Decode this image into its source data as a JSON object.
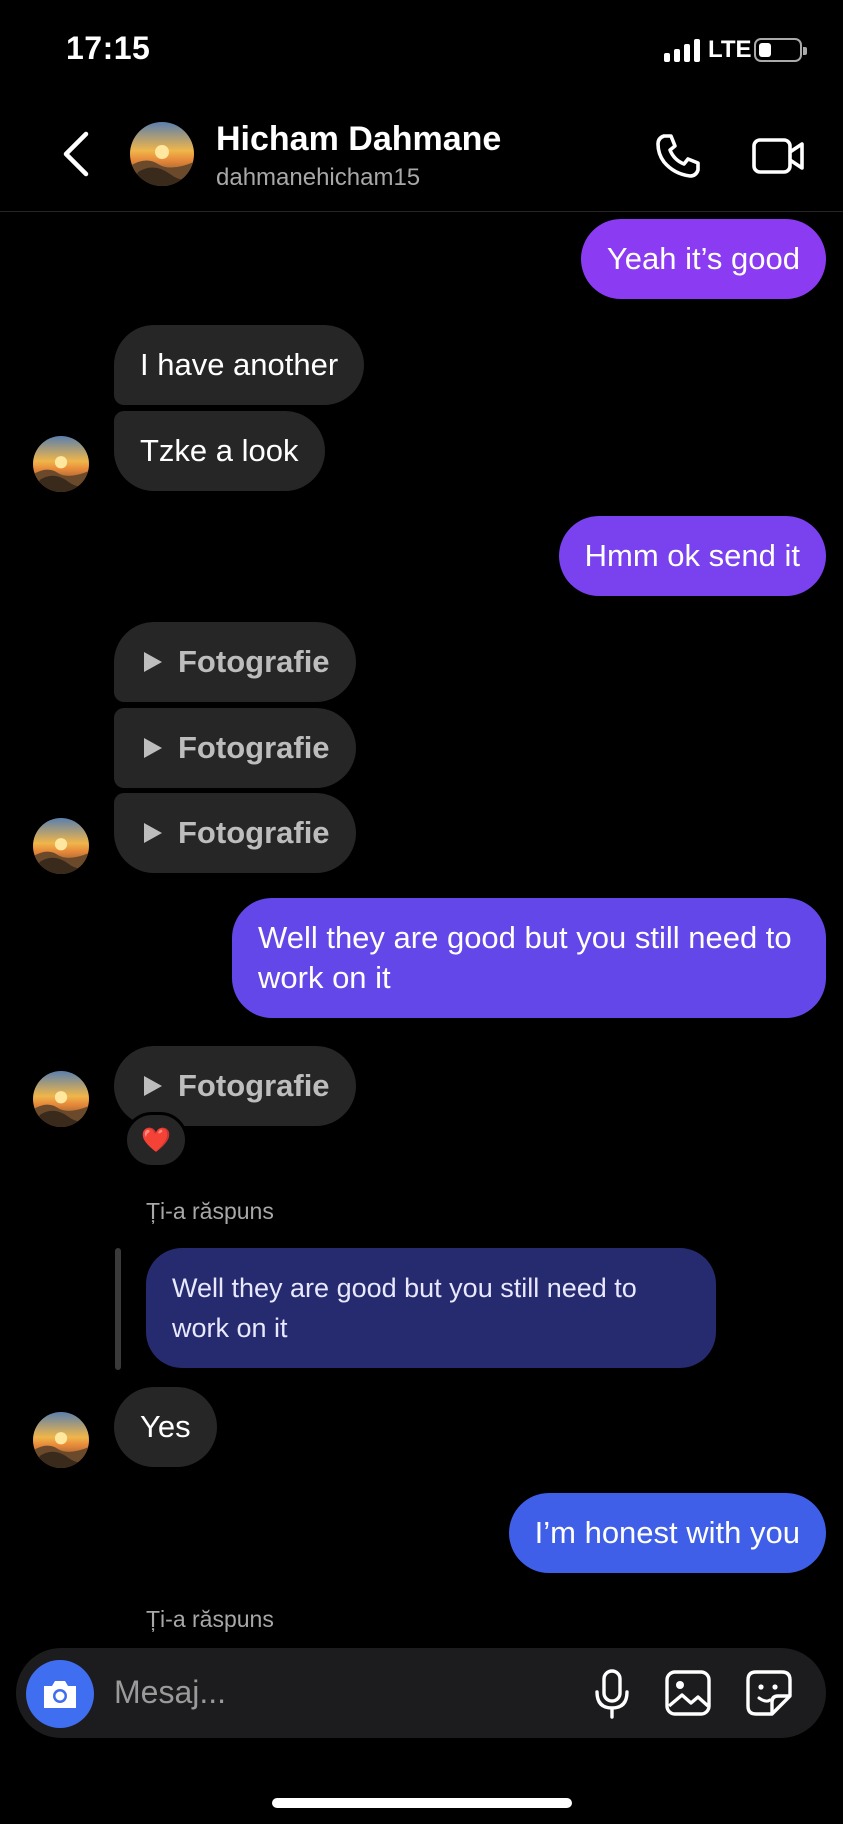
{
  "status": {
    "time": "17:15",
    "network": "LTE"
  },
  "header": {
    "name": "Hicham Dahmane",
    "username": "dahmanehicham15"
  },
  "messages": {
    "m1": "Yeah it’s good",
    "m2": "I have another",
    "m3": "Tzke a look",
    "m4": "Hmm ok send it",
    "p1": "Fotografie",
    "p2": "Fotografie",
    "p3": "Fotografie",
    "m5": "Well they are good but you still need to work on it",
    "p4": "Fotografie",
    "reaction": "❤️",
    "replied_label_1": "Ți-a răspuns",
    "quoted": "Well they are good but you still need to work on it",
    "m6": "Yes",
    "m7": "I’m honest with you",
    "replied_label_2": "Ți-a răspuns"
  },
  "composer": {
    "placeholder": "Mesaj..."
  },
  "colors": {
    "out_1": "#8b3cf2",
    "out_2": "#7a41ee",
    "out_3": "#6447e8",
    "out_4": "#3f5fe8",
    "incoming": "#262626",
    "camera": "#3f6ef1"
  },
  "icons": [
    "back-icon",
    "phone-icon",
    "video-icon",
    "play-icon",
    "heart-icon",
    "camera-icon",
    "mic-icon",
    "gallery-icon",
    "sticker-icon"
  ]
}
